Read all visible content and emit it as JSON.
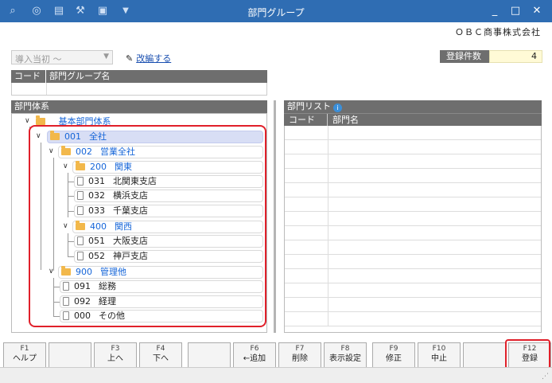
{
  "window": {
    "title": "部門グループ",
    "company": "ＯＢＣ商事株式会社",
    "toolbar_icons": [
      "search-plus-icon",
      "search-doc-icon",
      "print-icon",
      "tool-icon",
      "export-icon",
      "dropdown-arrow-icon"
    ],
    "controls": {
      "minimize": "_",
      "maximize": "□",
      "close": "✕"
    }
  },
  "header": {
    "period_select": "導入当初 ～",
    "edit_link": "改編する",
    "count_label": "登録件数",
    "count_value": "4"
  },
  "dept_group_table": {
    "columns": [
      "コード",
      "部門グループ名"
    ]
  },
  "tree": {
    "title": "部門体系",
    "root": "基本部門体系",
    "nodes": [
      {
        "code": "001",
        "name": "全社",
        "type": "folder"
      },
      {
        "code": "002",
        "name": "営業全社",
        "type": "folder"
      },
      {
        "code": "200",
        "name": "関東",
        "type": "folder"
      },
      {
        "code": "031",
        "name": "北関東支店",
        "type": "leaf"
      },
      {
        "code": "032",
        "name": "横浜支店",
        "type": "leaf"
      },
      {
        "code": "033",
        "name": "千葉支店",
        "type": "leaf"
      },
      {
        "code": "400",
        "name": "関西",
        "type": "folder"
      },
      {
        "code": "051",
        "name": "大阪支店",
        "type": "leaf"
      },
      {
        "code": "052",
        "name": "神戸支店",
        "type": "leaf"
      },
      {
        "code": "900",
        "name": "管理他",
        "type": "folder"
      },
      {
        "code": "091",
        "name": "総務",
        "type": "leaf"
      },
      {
        "code": "092",
        "name": "経理",
        "type": "leaf"
      },
      {
        "code": "000",
        "name": "その他",
        "type": "leaf"
      }
    ]
  },
  "dept_list": {
    "title": "部門リスト",
    "columns": [
      "コード",
      "部門名"
    ]
  },
  "fkeys": [
    {
      "key": "F1",
      "label": "ヘルプ"
    },
    {
      "key": "",
      "label": ""
    },
    {
      "key": "F3",
      "label": "上へ"
    },
    {
      "key": "F4",
      "label": "下へ"
    },
    {
      "key": "",
      "label": ""
    },
    {
      "key": "F6",
      "label": "←追加"
    },
    {
      "key": "F7",
      "label": "削除"
    },
    {
      "key": "F8",
      "label": "表示設定"
    },
    {
      "key": "F9",
      "label": "修正"
    },
    {
      "key": "F10",
      "label": "中止"
    },
    {
      "key": "",
      "label": ""
    },
    {
      "key": "F12",
      "label": "登録"
    }
  ]
}
